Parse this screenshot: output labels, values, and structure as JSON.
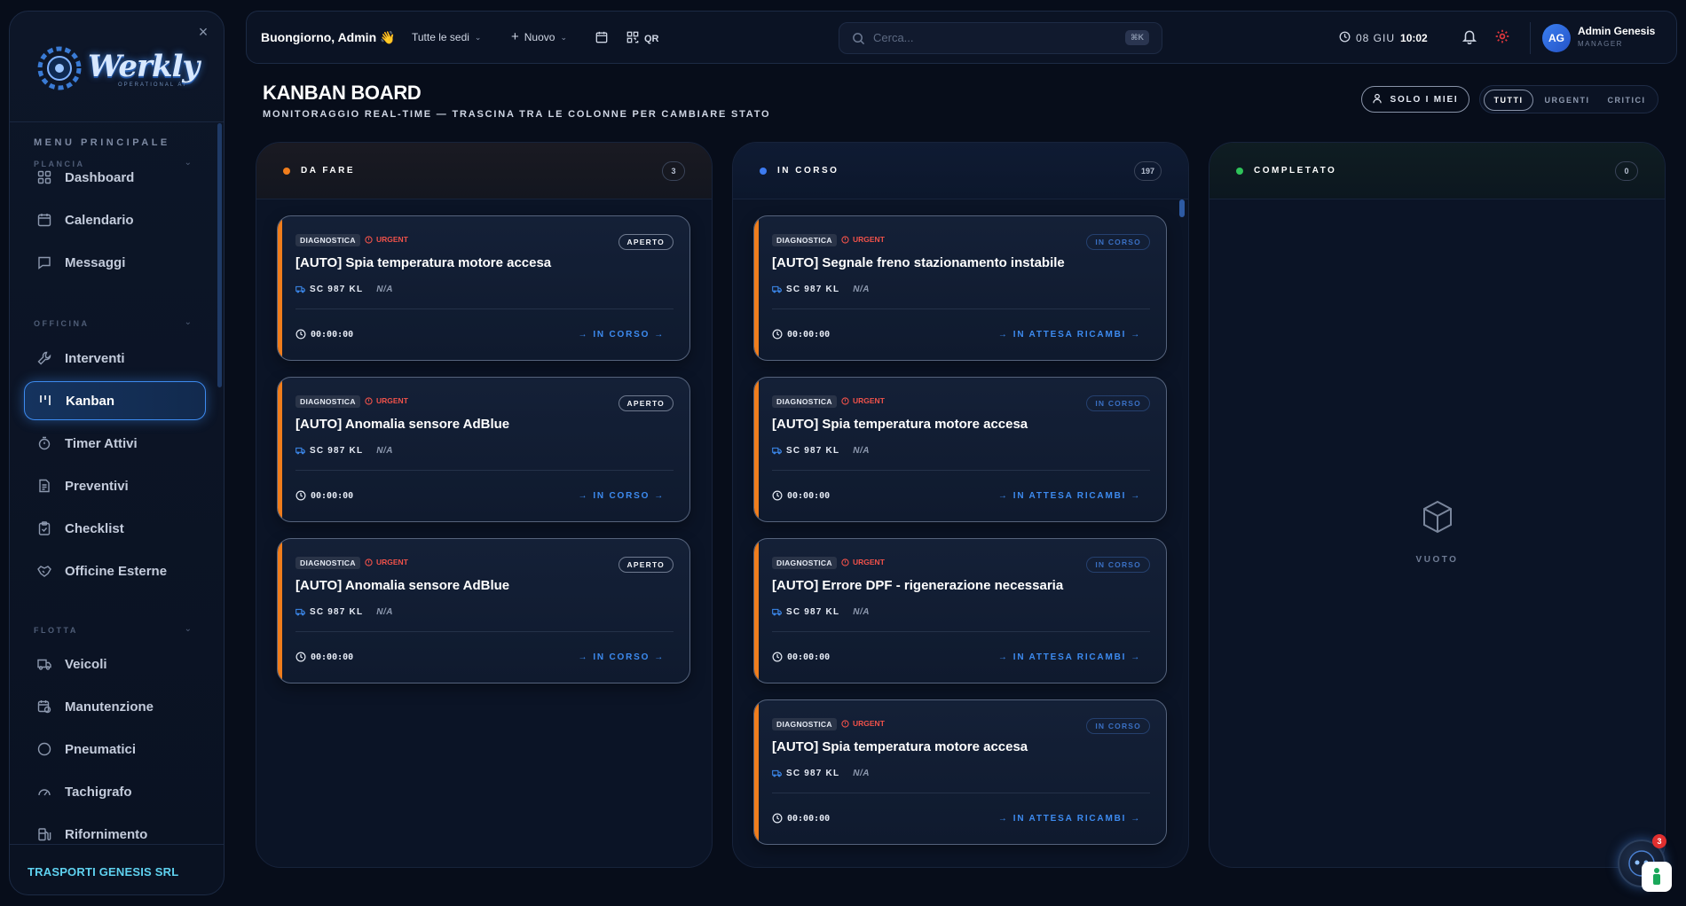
{
  "brand": {
    "logo_text": "Werkly",
    "logo_sub": "OPERATIONAL AI"
  },
  "sidebar": {
    "menu_title": "MENU PRINCIPALE",
    "sections": [
      {
        "title": "PLANCIA",
        "items": [
          {
            "label": "Dashboard",
            "icon": "dashboard-icon"
          },
          {
            "label": "Calendario",
            "icon": "calendar-icon"
          },
          {
            "label": "Messaggi",
            "icon": "message-icon"
          }
        ]
      },
      {
        "title": "OFFICINA",
        "items": [
          {
            "label": "Interventi",
            "icon": "wrench-icon"
          },
          {
            "label": "Kanban",
            "icon": "kanban-icon",
            "active": true
          },
          {
            "label": "Timer Attivi",
            "icon": "timer-icon"
          },
          {
            "label": "Preventivi",
            "icon": "document-icon"
          },
          {
            "label": "Checklist",
            "icon": "clipboard-icon"
          },
          {
            "label": "Officine Esterne",
            "icon": "handshake-icon"
          }
        ]
      },
      {
        "title": "FLOTTA",
        "items": [
          {
            "label": "Veicoli",
            "icon": "truck-icon"
          },
          {
            "label": "Manutenzione",
            "icon": "maintenance-calendar-icon"
          },
          {
            "label": "Pneumatici",
            "icon": "tire-icon"
          },
          {
            "label": "Tachigrafo",
            "icon": "gauge-icon"
          },
          {
            "label": "Rifornimento",
            "icon": "fuel-icon"
          }
        ]
      }
    ],
    "company": "TRASPORTI GENESIS SRL"
  },
  "topbar": {
    "greeting": "Buongiorno, Admin 👋",
    "location_select": "Tutte le sedi",
    "new_label": "Nuovo",
    "qr_label": "QR",
    "search_placeholder": "Cerca...",
    "search_shortcut": "⌘K",
    "date": "08 GIU",
    "time": "10:02",
    "user": {
      "initials": "AG",
      "name": "Admin Genesis",
      "role": "MANAGER"
    }
  },
  "page": {
    "title": "KANBAN BOARD",
    "subtitle": "MONITORAGGIO REAL-TIME — TRASCINA TRA LE COLONNE PER CAMBIARE STATO",
    "mine_label": "SOLO I MIEI",
    "filters": [
      "TUTTI",
      "URGENTI",
      "CRITICI"
    ],
    "active_filter": "TUTTI"
  },
  "columns": [
    {
      "title": "DA FARE",
      "count": "3",
      "dot_color": "#f07d1c",
      "cards": [
        {
          "tag": "DIAGNOSTICA",
          "priority": "URGENT",
          "status": "APERTO",
          "title": "[AUTO] Spia temperatura motore accesa",
          "plate": "SC 987 KL",
          "driver": "N/A",
          "timer": "00:00:00",
          "action": "IN CORSO"
        },
        {
          "tag": "DIAGNOSTICA",
          "priority": "URGENT",
          "status": "APERTO",
          "title": "[AUTO] Anomalia sensore AdBlue",
          "plate": "SC 987 KL",
          "driver": "N/A",
          "timer": "00:00:00",
          "action": "IN CORSO"
        },
        {
          "tag": "DIAGNOSTICA",
          "priority": "URGENT",
          "status": "APERTO",
          "title": "[AUTO] Anomalia sensore AdBlue",
          "plate": "SC 987 KL",
          "driver": "N/A",
          "timer": "00:00:00",
          "action": "IN CORSO"
        }
      ]
    },
    {
      "title": "IN CORSO",
      "count": "197",
      "dot_color": "#3d7bf0",
      "cards": [
        {
          "tag": "DIAGNOSTICA",
          "priority": "URGENT",
          "status": "IN CORSO",
          "title": "[AUTO] Segnale freno stazionamento instabile",
          "plate": "SC 987 KL",
          "driver": "N/A",
          "timer": "00:00:00",
          "action": "IN ATTESA RICAMBI"
        },
        {
          "tag": "DIAGNOSTICA",
          "priority": "URGENT",
          "status": "IN CORSO",
          "title": "[AUTO] Spia temperatura motore accesa",
          "plate": "SC 987 KL",
          "driver": "N/A",
          "timer": "00:00:00",
          "action": "IN ATTESA RICAMBI"
        },
        {
          "tag": "DIAGNOSTICA",
          "priority": "URGENT",
          "status": "IN CORSO",
          "title": "[AUTO] Errore DPF - rigenerazione necessaria",
          "plate": "SC 987 KL",
          "driver": "N/A",
          "timer": "00:00:00",
          "action": "IN ATTESA RICAMBI"
        },
        {
          "tag": "DIAGNOSTICA",
          "priority": "URGENT",
          "status": "IN CORSO",
          "title": "[AUTO] Spia temperatura motore accesa",
          "plate": "SC 987 KL",
          "driver": "N/A",
          "timer": "00:00:00",
          "action": "IN ATTESA RICAMBI"
        }
      ]
    },
    {
      "title": "COMPLETATO",
      "count": "0",
      "dot_color": "#2fc35a",
      "empty_label": "VUOTO",
      "cards": []
    }
  ],
  "assistant": {
    "badge_count": "3"
  }
}
